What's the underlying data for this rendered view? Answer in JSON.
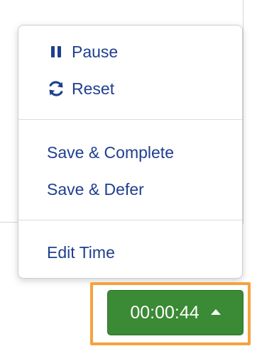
{
  "menu": {
    "items": [
      {
        "label": "Pause",
        "icon": "pause-icon"
      },
      {
        "label": "Reset",
        "icon": "refresh-icon"
      },
      {
        "label": "Save & Complete"
      },
      {
        "label": "Save & Defer"
      },
      {
        "label": "Edit Time"
      }
    ]
  },
  "timer": {
    "value": "00:00:44",
    "caret_icon": "caret-up-icon"
  },
  "colors": {
    "menu_text": "#1f3f8f",
    "timer_bg": "#3b8a35",
    "highlight": "#f5a23c"
  }
}
